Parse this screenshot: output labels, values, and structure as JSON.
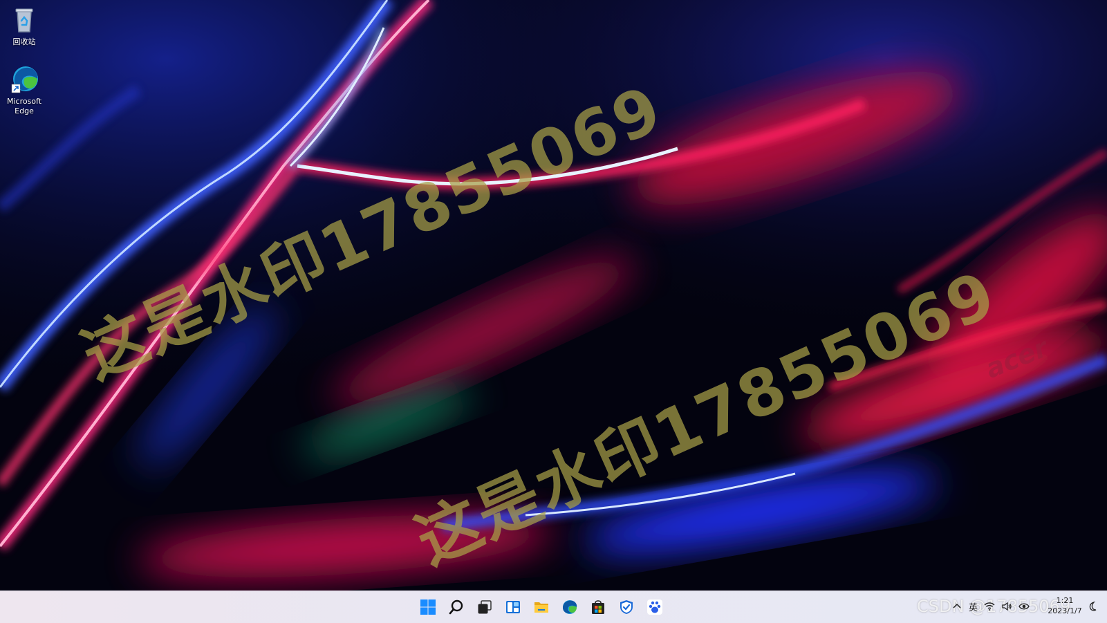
{
  "desktop": {
    "icons": [
      {
        "label": "回收站",
        "icon": "recycle-bin-icon"
      },
      {
        "label": "Microsoft Edge",
        "icon": "edge-icon"
      }
    ],
    "watermarks": [
      "这是水印17855069",
      "这是水印17855069"
    ],
    "brand_logo": "acer"
  },
  "taskbar": {
    "pinned": [
      {
        "name": "start",
        "icon": "windows-start-icon"
      },
      {
        "name": "search",
        "icon": "search-icon"
      },
      {
        "name": "task-view",
        "icon": "task-view-icon"
      },
      {
        "name": "widgets",
        "icon": "widgets-icon"
      },
      {
        "name": "file-explorer",
        "icon": "folder-icon"
      },
      {
        "name": "edge",
        "icon": "edge-icon"
      },
      {
        "name": "store",
        "icon": "store-icon"
      },
      {
        "name": "security",
        "icon": "shield-icon"
      },
      {
        "name": "baidu",
        "icon": "paw-icon"
      }
    ],
    "tray": {
      "chevron": "^",
      "ime": "英",
      "icons": [
        "wifi-icon",
        "volume-icon",
        "eye-icon"
      ]
    },
    "clock": {
      "time": "1:21",
      "date": "2023/1/7"
    },
    "credit": "CSDN @17855069"
  },
  "colors": {
    "taskbar_bg": "#ece8f1",
    "watermark": "#a8a046",
    "start_blue": "#1a8cff"
  }
}
